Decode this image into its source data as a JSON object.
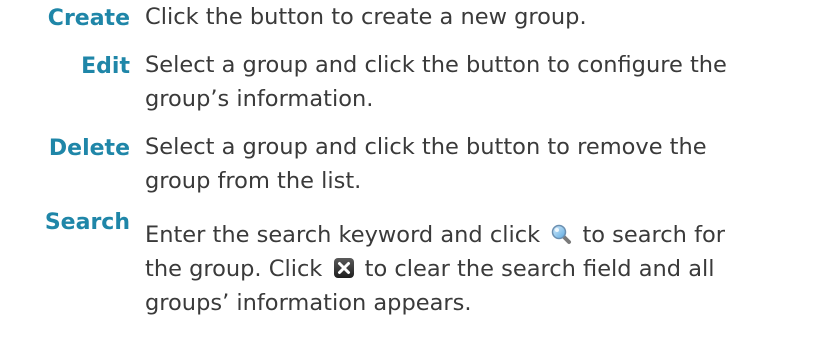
{
  "entries": [
    {
      "term": "Create",
      "lines": [
        "Click the button to create a new group."
      ]
    },
    {
      "term": "Edit",
      "lines": [
        "Select a group and click the button to configure the",
        "group’s information."
      ]
    },
    {
      "term": "Delete",
      "lines": [
        "Select a group and click the button to remove the",
        "group from the list."
      ]
    },
    {
      "term": "Search",
      "line1_before": "Enter the search keyword and click",
      "line1_after": "to search for",
      "line2_before": "the group. Click",
      "line2_after": "to clear the search field and all",
      "line3": "groups’ information appears.",
      "icons": [
        "search-icon",
        "clear-icon"
      ]
    }
  ],
  "colors": {
    "term": "#1f86a8",
    "body_text": "#3a3a3a"
  }
}
